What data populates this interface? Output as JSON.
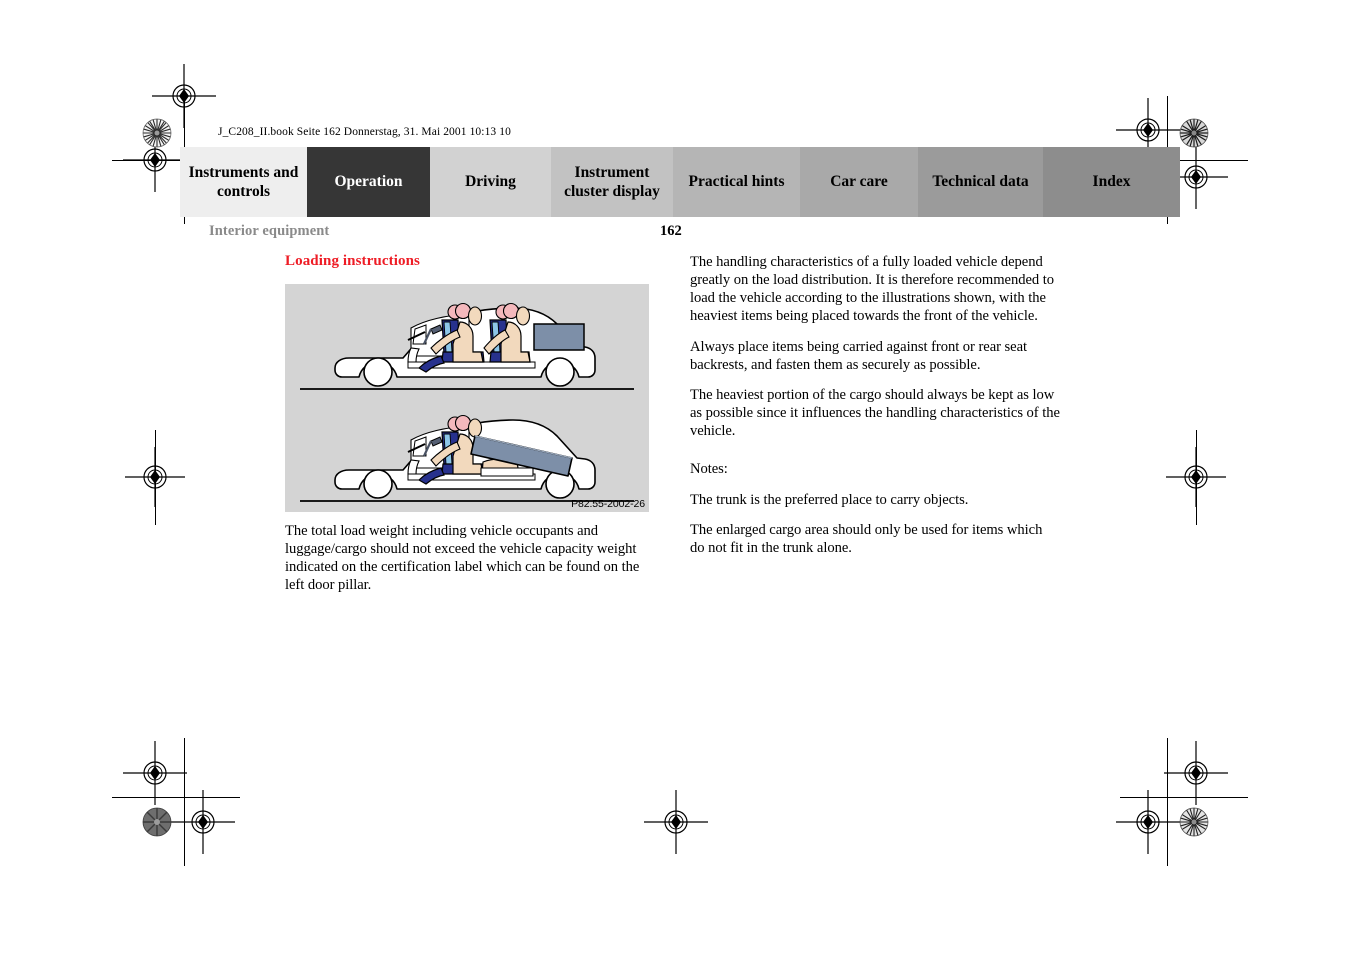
{
  "document": {
    "header_line": "J_C208_II.book  Seite 162  Donnerstag, 31. Mai 2001  10:13 10",
    "running_head": "Interior equipment",
    "page_number": "162"
  },
  "tabbar": {
    "tabs": [
      {
        "label": "Instruments and controls",
        "color": "#eeeeee",
        "active": false
      },
      {
        "label": "Operation",
        "color": "#363636",
        "active": true
      },
      {
        "label": "Driving",
        "color": "#d2d2d2",
        "active": false
      },
      {
        "label": "Instrument cluster display",
        "color": "#c2c2c2",
        "active": false
      },
      {
        "label": "Practical hints",
        "color": "#b5b5b5",
        "active": false
      },
      {
        "label": "Car care",
        "color": "#a9a9a9",
        "active": false
      },
      {
        "label": "Technical data",
        "color": "#9b9b9b",
        "active": false
      },
      {
        "label": "Index",
        "color": "#8d8d8d",
        "active": false
      }
    ]
  },
  "colors": {
    "heading_red": "#ee1c25",
    "running_head_gray": "#8a8a8a",
    "figure_background": "#d4d4d4",
    "seat_navy": "#2c3e8f",
    "seat_light_blue": "#8ec6e8",
    "body_tan": "#f2d9bd",
    "head_pink": "#f4b8bc",
    "cargo_slate": "#7d8fa8"
  },
  "left_column": {
    "section_title": "Loading instructions",
    "figure": {
      "caption": "P82.55-2002-26",
      "alt_top": "Side view of vehicle loaded correctly with cargo in the trunk and two occupants seated",
      "alt_bottom": "Side view of vehicle with rear seat backrest folded and a long item extending into the cabin"
    },
    "paragraphs": [
      "The total load weight including vehicle occupants and luggage/cargo should not exceed the vehicle capacity weight indicated on the certification label which can be found on the left door pillar."
    ]
  },
  "right_column": {
    "paragraphs": [
      "The handling characteristics of a fully loaded vehicle depend greatly on the load distribution. It is therefore recommended to load the vehicle according to the illustrations shown, with the heaviest items being placed towards the front of the vehicle.",
      "Always place items being carried against front or rear seat backrests, and fasten them as securely as possible.",
      "The heaviest portion of the cargo should always be kept as low as possible since it influences the handling characteristics of the vehicle."
    ],
    "notes_label": "Notes:",
    "notes": [
      "The trunk is the preferred place to carry objects.",
      "The enlarged cargo area should only be used for items which do not fit in the trunk alone."
    ]
  }
}
